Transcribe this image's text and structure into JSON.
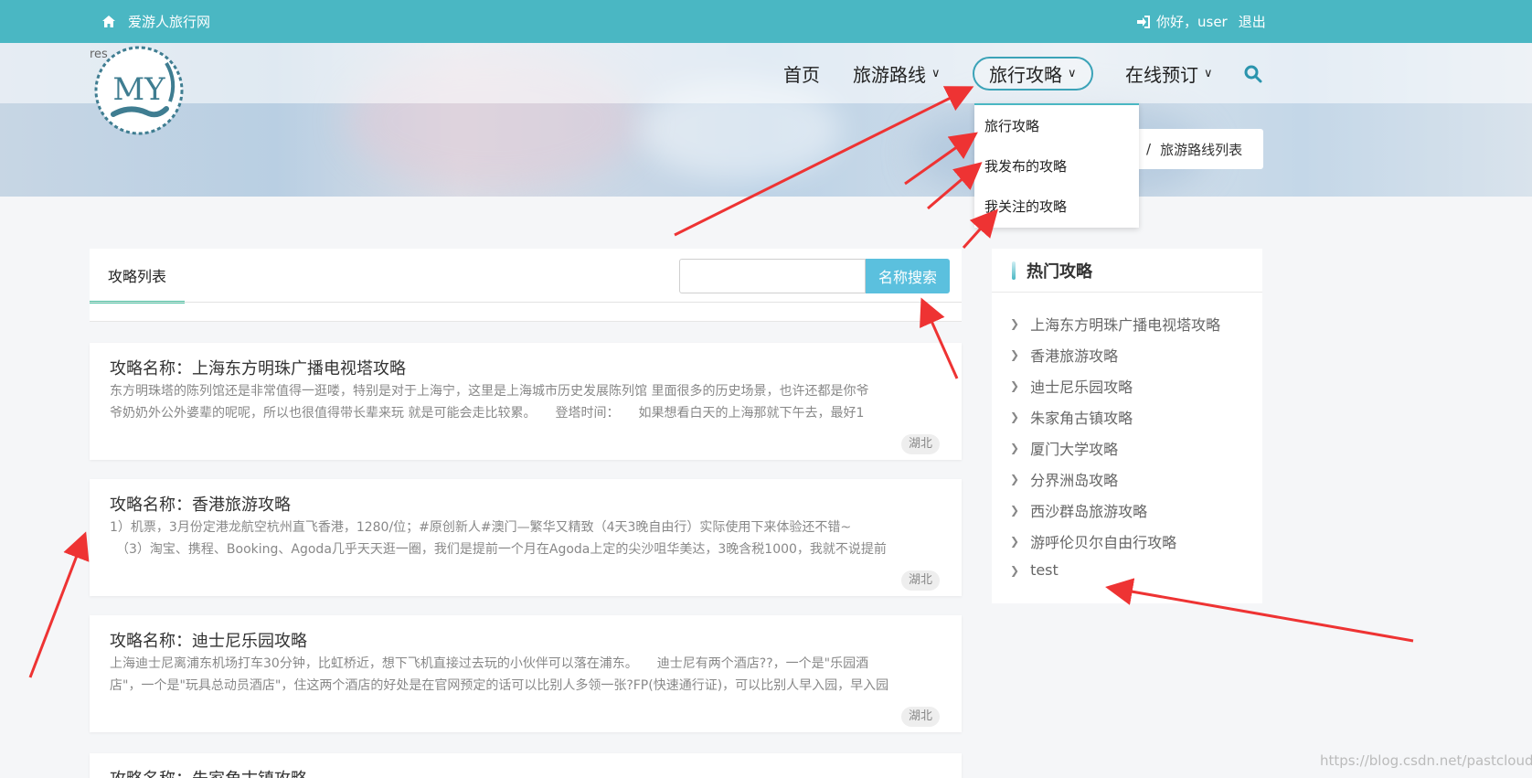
{
  "topbar": {
    "site_name": "爱游人旅行网",
    "greeting": "你好，user",
    "logout": "退出"
  },
  "logo": {
    "text": "MY",
    "tag": "res"
  },
  "nav": {
    "items": [
      {
        "label": "首页"
      },
      {
        "label": "旅游路线"
      },
      {
        "label": "旅行攻略"
      },
      {
        "label": "在线预订"
      }
    ]
  },
  "breadcrumb": {
    "separator": "/",
    "current": "旅游路线列表"
  },
  "dropdown": {
    "items": [
      "旅行攻略",
      "我发布的攻略",
      "我关注的攻略"
    ]
  },
  "tabs": {
    "active": "攻略列表"
  },
  "search": {
    "value": "",
    "button": "名称搜索"
  },
  "articles": [
    {
      "title": "攻略名称：上海东方明珠广播电视塔攻略",
      "line1": "东方明珠塔的陈列馆还是非常值得一逛喽，特别是对于上海宁，这里是上海城市历史发展陈列馆 里面很多的历史场景，也许还都是你爷",
      "line2": "爷奶奶外公外婆辈的呢呢，所以也很值得带长辈来玩 就是可能会走比较累。　　登塔时间：　　如果想看白天的上海那就下午去，最好1",
      "tag": "湖北"
    },
    {
      "title": "攻略名称：香港旅游攻略",
      "line1": "1）机票，3月份定港龙航空杭州直飞香港，1280/位；#原创新人#澳门—繁华又精致（4天3晚自由行）实际使用下来体验还不错~",
      "line2": "　（3）淘宝、携程、Booking、Agoda几乎天天逛一圈，我们是提前一个月在Agoda上定的尖沙咀华美达，3晚含税1000，我就不说提前",
      "tag": "湖北"
    },
    {
      "title": "攻略名称：迪士尼乐园攻略",
      "line1": "上海迪士尼离浦东机场打车30分钟，比虹桥近，想下飞机直接过去玩的小伙伴可以落在浦东。　　迪士尼有两个酒店??，一个是\"乐园酒",
      "line2": "店\"，一个是\"玩具总动员酒店\"，住这两个酒店的好处是在官网预定的话可以比别人多领一张?FP(快速通行证)，可以比别人早入园，早入园",
      "tag": "湖北"
    },
    {
      "title": "攻略名称：朱家角古镇攻略",
      "line1": "",
      "line2": "",
      "tag": ""
    }
  ],
  "sidebar": {
    "title": "热门攻略",
    "items": [
      "上海东方明珠广播电视塔攻略",
      "香港旅游攻略",
      "迪士尼乐园攻略",
      "朱家角古镇攻略",
      "厦门大学攻略",
      "分界洲岛攻略",
      "西沙群岛旅游攻略",
      "游呼伦贝尔自由行攻略",
      "test"
    ]
  },
  "watermark": "https://blog.csdn.net/pastclouds",
  "colors": {
    "topbar": "#4ab7c3",
    "accent": "#5bc0de",
    "tab_underline": "#4cc3a4",
    "annotation_arrow": "#ee3333"
  },
  "icons": {
    "home": "home-icon",
    "login": "sign-in-icon",
    "search": "search-icon",
    "chevron": "chevron-down-icon",
    "sidebar_chevron": "chevron-right-icon"
  }
}
